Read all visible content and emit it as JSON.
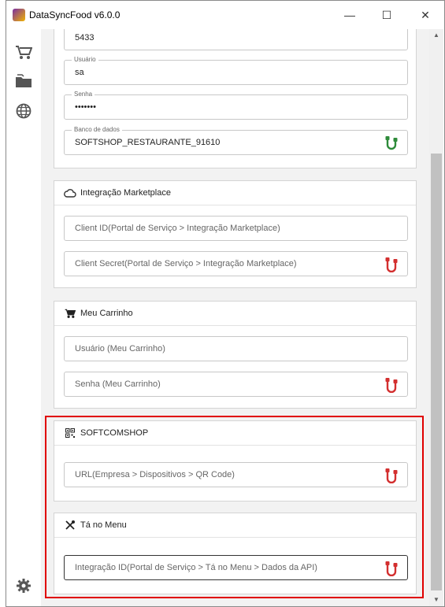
{
  "window": {
    "title": "DataSyncFood v6.0.0",
    "minimize": "—",
    "maximize": "☐",
    "close": "✕"
  },
  "sidebar": {
    "items": [
      {
        "name": "cart-icon"
      },
      {
        "name": "folder-icon"
      },
      {
        "name": "globe-icon"
      }
    ],
    "settings": "gear-icon"
  },
  "database_card": {
    "port_value": "5433",
    "user_label": "Usuário",
    "user_value": "sa",
    "password_label": "Senha",
    "password_value": "•••••••",
    "db_label": "Banco de dados",
    "db_value": "SOFTSHOP_RESTAURANTE_91610"
  },
  "marketplace_card": {
    "title": "Integração Marketplace",
    "client_id_placeholder": "Client ID(Portal de Serviço > Integração Marketplace)",
    "client_secret_placeholder": "Client Secret(Portal de Serviço > Integração Marketplace)"
  },
  "carrinho_card": {
    "title": "Meu Carrinho",
    "user_placeholder": "Usuário (Meu Carrinho)",
    "password_placeholder": "Senha (Meu Carrinho)"
  },
  "softcomshop_card": {
    "title": "SOFTCOMSHOP",
    "url_placeholder": "URL(Empresa > Dispositivos > QR Code)"
  },
  "tanomenu_card": {
    "title": "Tá no Menu",
    "integration_placeholder": "Integração ID(Portal de Serviço > Tá no Menu > Dados da API)"
  },
  "colors": {
    "connected": "#2e8b3a",
    "disconnected": "#d32f2f",
    "highlight": "#e00000"
  }
}
